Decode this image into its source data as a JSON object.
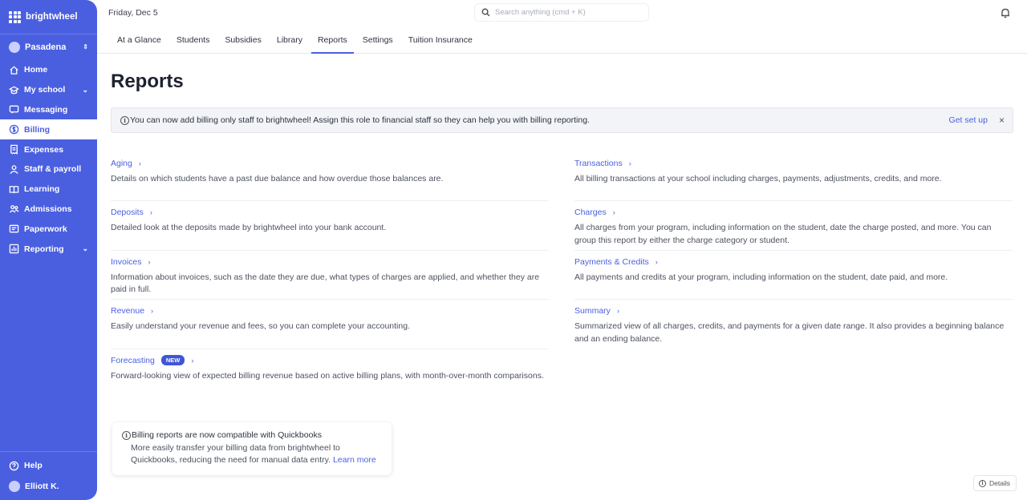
{
  "sidebar": {
    "brand": "brightwheel",
    "location": "Pasadena",
    "items": [
      {
        "label": "Home",
        "icon": "home-icon"
      },
      {
        "label": "My school",
        "icon": "school-icon",
        "chevron": true
      },
      {
        "label": "Messaging",
        "icon": "message-icon"
      },
      {
        "label": "Billing",
        "icon": "dollar-icon",
        "active": true
      },
      {
        "label": "Expenses",
        "icon": "receipt-icon"
      },
      {
        "label": "Staff & payroll",
        "icon": "staff-icon"
      },
      {
        "label": "Learning",
        "icon": "book-icon"
      },
      {
        "label": "Admissions",
        "icon": "admissions-icon"
      },
      {
        "label": "Paperwork",
        "icon": "paperwork-icon"
      },
      {
        "label": "Reporting",
        "icon": "chart-icon",
        "chevron": true
      }
    ],
    "help": "Help",
    "user": "Elliott K."
  },
  "topbar": {
    "date": "Friday, Dec 5",
    "search_placeholder": "Search anything (cmd + K)"
  },
  "tabs": [
    {
      "label": "At a Glance"
    },
    {
      "label": "Students"
    },
    {
      "label": "Subsidies"
    },
    {
      "label": "Library"
    },
    {
      "label": "Reports",
      "active": true
    },
    {
      "label": "Settings"
    },
    {
      "label": "Tuition Insurance"
    }
  ],
  "page": {
    "title": "Reports"
  },
  "banner": {
    "text": "You can now add billing only staff to brightwheel! Assign this role to financial staff so they can help you with billing reporting.",
    "action": "Get set up",
    "close": "×"
  },
  "reports_left": [
    {
      "title": "Aging",
      "desc": "Details on which students have a past due balance and how overdue those balances are."
    },
    {
      "title": "Deposits",
      "desc": "Detailed look at the deposits made by brightwheel into your bank account."
    },
    {
      "title": "Invoices",
      "desc": "Information about invoices, such as the date they are due, what types of charges are applied, and whether they are paid in full."
    },
    {
      "title": "Revenue",
      "desc": "Easily understand your revenue and fees, so you can complete your accounting."
    },
    {
      "title": "Forecasting",
      "badge": "NEW",
      "desc": "Forward-looking view of expected billing revenue based on active billing plans, with month-over-month comparisons."
    }
  ],
  "reports_right": [
    {
      "title": "Transactions",
      "desc": "All billing transactions at your school including charges, payments, adjustments, credits, and more."
    },
    {
      "title": "Charges",
      "desc": "All charges from your program, including information on the student, date the charge posted, and more. You can group this report by either the charge category or student."
    },
    {
      "title": "Payments & Credits",
      "desc": "All payments and credits at your program, including information on the student, date paid, and more."
    },
    {
      "title": "Summary",
      "desc": "Summarized view of all charges, credits, and payments for a given date range. It also provides a beginning balance and an ending balance."
    }
  ],
  "quickbooks": {
    "title": "Billing reports are now compatible with Quickbooks",
    "body": "More easily transfer your billing data from brightwheel to Quickbooks, reducing the need for manual data entry.",
    "link": "Learn more"
  },
  "details_button": "Details"
}
